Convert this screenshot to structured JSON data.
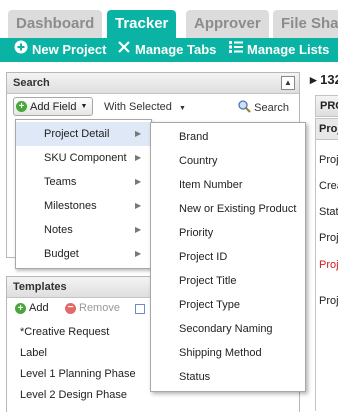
{
  "nav": {
    "tabs": [
      {
        "label": "Dashboard"
      },
      {
        "label": "Tracker"
      },
      {
        "label": "Approver"
      },
      {
        "label": "File Sha"
      }
    ]
  },
  "toolbar": {
    "new_project": "New Project",
    "manage_tabs": "Manage Tabs",
    "manage_lists": "Manage Lists"
  },
  "search_panel": {
    "title": "Search",
    "add_field": "Add Field",
    "with_selected": "With Selected",
    "search": "Search"
  },
  "templates_panel": {
    "title": "Templates",
    "add": "Add",
    "remove": "Remove",
    "items": [
      "*Creative Request",
      "Label",
      "Level 1 Planning Phase",
      "Level 2 Design Phase"
    ]
  },
  "right_panel": {
    "title": "132",
    "header1": "PRO",
    "header2": "Proj",
    "lines": [
      {
        "text": "Proj",
        "red": false
      },
      {
        "text": "Crea",
        "red": false
      },
      {
        "text": "Stat",
        "red": false
      },
      {
        "text": "Proj",
        "red": false
      },
      {
        "text": "Proj",
        "red": true
      },
      {
        "text": "Proj",
        "red": false
      }
    ]
  },
  "add_field_menu": {
    "items": [
      "Project Detail",
      "SKU Component",
      "Teams",
      "Milestones",
      "Notes",
      "Budget"
    ],
    "highlighted": "Project Detail"
  },
  "project_detail_submenu": {
    "items": [
      "Brand",
      "Country",
      "Item Number",
      "New or Existing Product",
      "Priority",
      "Project ID",
      "Project Title",
      "Project Type",
      "Secondary Naming",
      "Shipping Method",
      "Status"
    ]
  },
  "colors": {
    "accent": "#0ab3a3",
    "tab_inactive": "#dcdcdc",
    "highlight": "#dfe8f6"
  }
}
